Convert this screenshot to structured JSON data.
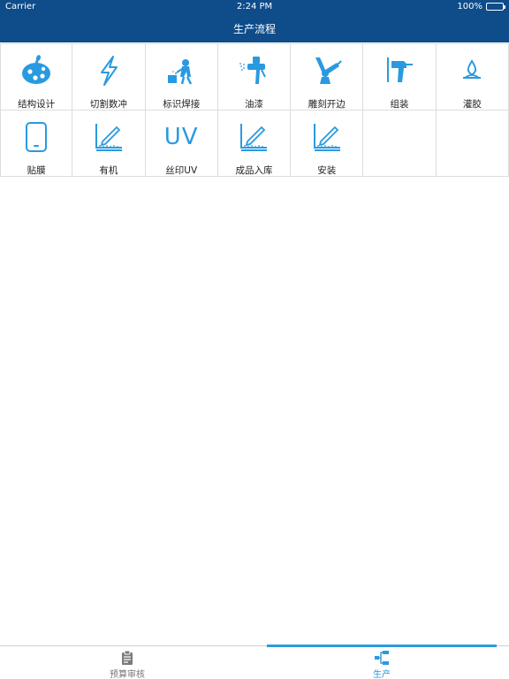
{
  "status_bar": {
    "carrier": "Carrier",
    "time": "2:24 PM",
    "battery": "100%"
  },
  "nav": {
    "title": "生产流程"
  },
  "colors": {
    "nav_background": "#0e4c8a",
    "accent": "#2a9ae0",
    "grid_line": "#dddddd"
  },
  "grid": {
    "items": [
      {
        "label": "结构设计",
        "icon": "palette-icon"
      },
      {
        "label": "切割数冲",
        "icon": "lightning-icon"
      },
      {
        "label": "标识焊接",
        "icon": "welder-icon"
      },
      {
        "label": "油漆",
        "icon": "spray-gun-icon"
      },
      {
        "label": "雕刻开边",
        "icon": "robot-arm-icon"
      },
      {
        "label": "组装",
        "icon": "drill-icon"
      },
      {
        "label": "灌胶",
        "icon": "drop-icon"
      },
      {
        "label": "贴膜",
        "icon": "tablet-icon"
      },
      {
        "label": "有机",
        "icon": "ruler-pencil-icon"
      },
      {
        "label": "丝印UV",
        "icon": "uv-text-icon",
        "icon_text": "UV"
      },
      {
        "label": "成品入库",
        "icon": "ruler-pencil-icon"
      },
      {
        "label": "安装",
        "icon": "ruler-pencil-icon"
      }
    ]
  },
  "tab_bar": {
    "tabs": [
      {
        "label": "预算审核",
        "icon": "clipboard-icon",
        "active": false
      },
      {
        "label": "生产",
        "icon": "flow-icon",
        "active": true
      }
    ]
  }
}
